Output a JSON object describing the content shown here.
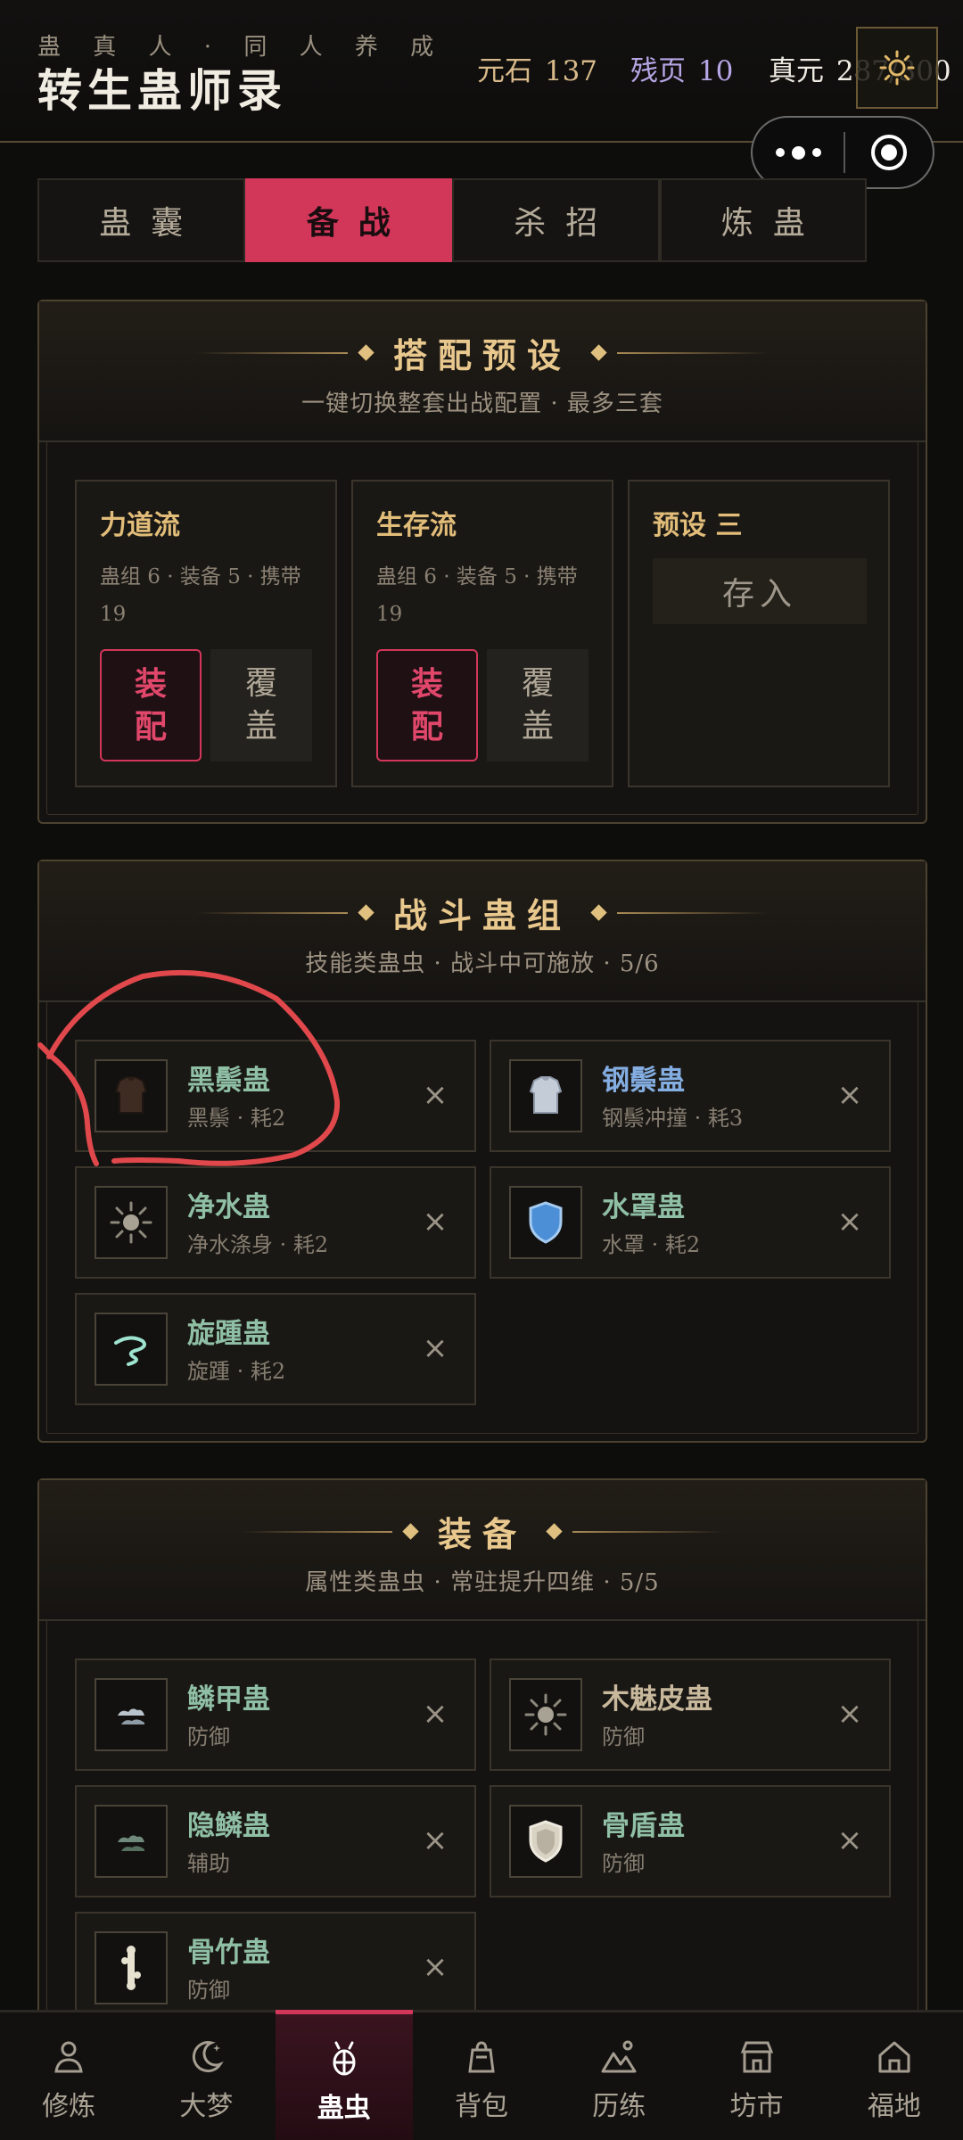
{
  "header": {
    "subtitle": "蛊 真 人 · 同 人 养 成",
    "title": "转生蛊师录",
    "resources": [
      {
        "label": "元石",
        "value": "137"
      },
      {
        "label": "残页",
        "value": "10"
      },
      {
        "label": "真元",
        "value": "287/300"
      }
    ]
  },
  "tabs": [
    {
      "label": "蛊囊",
      "active": false
    },
    {
      "label": "备战",
      "active": true
    },
    {
      "label": "杀招",
      "active": false
    },
    {
      "label": "炼蛊",
      "active": false
    }
  ],
  "presets_panel": {
    "title": "搭配预设",
    "subtitle": "一键切换整套出战配置 · 最多三套",
    "presets": [
      {
        "name": "力道流",
        "stats": "蛊组 6 · 装备 5 · 携带 19",
        "equip_label": "装配",
        "cover_label": "覆盖"
      },
      {
        "name": "生存流",
        "stats": "蛊组 6 · 装备 5 · 携带 19",
        "equip_label": "装配",
        "cover_label": "覆盖"
      },
      {
        "name": "预设 三",
        "save_label": "存入"
      }
    ]
  },
  "battle_panel": {
    "title": "战斗蛊组",
    "subtitle": "技能类蛊虫 · 战斗中可施放 · 5/6",
    "items": [
      {
        "name": "黑鬃蛊",
        "desc": "黑鬃 · 耗2",
        "icon": "dark-armor-icon"
      },
      {
        "name": "钢鬃蛊",
        "desc": "钢鬃冲撞 · 耗3",
        "icon": "steel-armor-icon"
      },
      {
        "name": "净水蛊",
        "desc": "净水涤身 · 耗2",
        "icon": "sun-icon"
      },
      {
        "name": "水罩蛊",
        "desc": "水罩 · 耗2",
        "icon": "blue-shield-icon"
      },
      {
        "name": "旋踵蛊",
        "desc": "旋踵 · 耗2",
        "icon": "swirl-icon"
      }
    ],
    "remove_label": "×"
  },
  "equip_panel": {
    "title": "装备",
    "subtitle": "属性类蛊虫 · 常驻提升四维 · 5/5",
    "items": [
      {
        "name": "鳞甲蛊",
        "desc": "防御",
        "icon": "scale-icon"
      },
      {
        "name": "木魅皮蛊",
        "desc": "防御",
        "icon": "sun-icon"
      },
      {
        "name": "隐鳞蛊",
        "desc": "辅助",
        "icon": "scale-icon"
      },
      {
        "name": "骨盾蛊",
        "desc": "防御",
        "icon": "bone-shield-icon"
      },
      {
        "name": "骨竹蛊",
        "desc": "防御",
        "icon": "bone-bamboo-icon"
      }
    ],
    "remove_label": "×"
  },
  "bottom_nav": [
    {
      "label": "修炼",
      "icon": "person-icon",
      "active": false
    },
    {
      "label": "大梦",
      "icon": "moon-icon",
      "active": false
    },
    {
      "label": "蛊虫",
      "icon": "bug-icon",
      "active": true
    },
    {
      "label": "背包",
      "icon": "bag-icon",
      "active": false
    },
    {
      "label": "历练",
      "icon": "mountain-icon",
      "active": false
    },
    {
      "label": "坊市",
      "icon": "shop-icon",
      "active": false
    },
    {
      "label": "福地",
      "icon": "home-icon",
      "active": false
    }
  ],
  "colors": {
    "accent": "#d2375a",
    "gold": "#e9c88e",
    "green_name": "#8fbfa4",
    "blue_name": "#84aee2",
    "annotation": "#e0484c"
  }
}
